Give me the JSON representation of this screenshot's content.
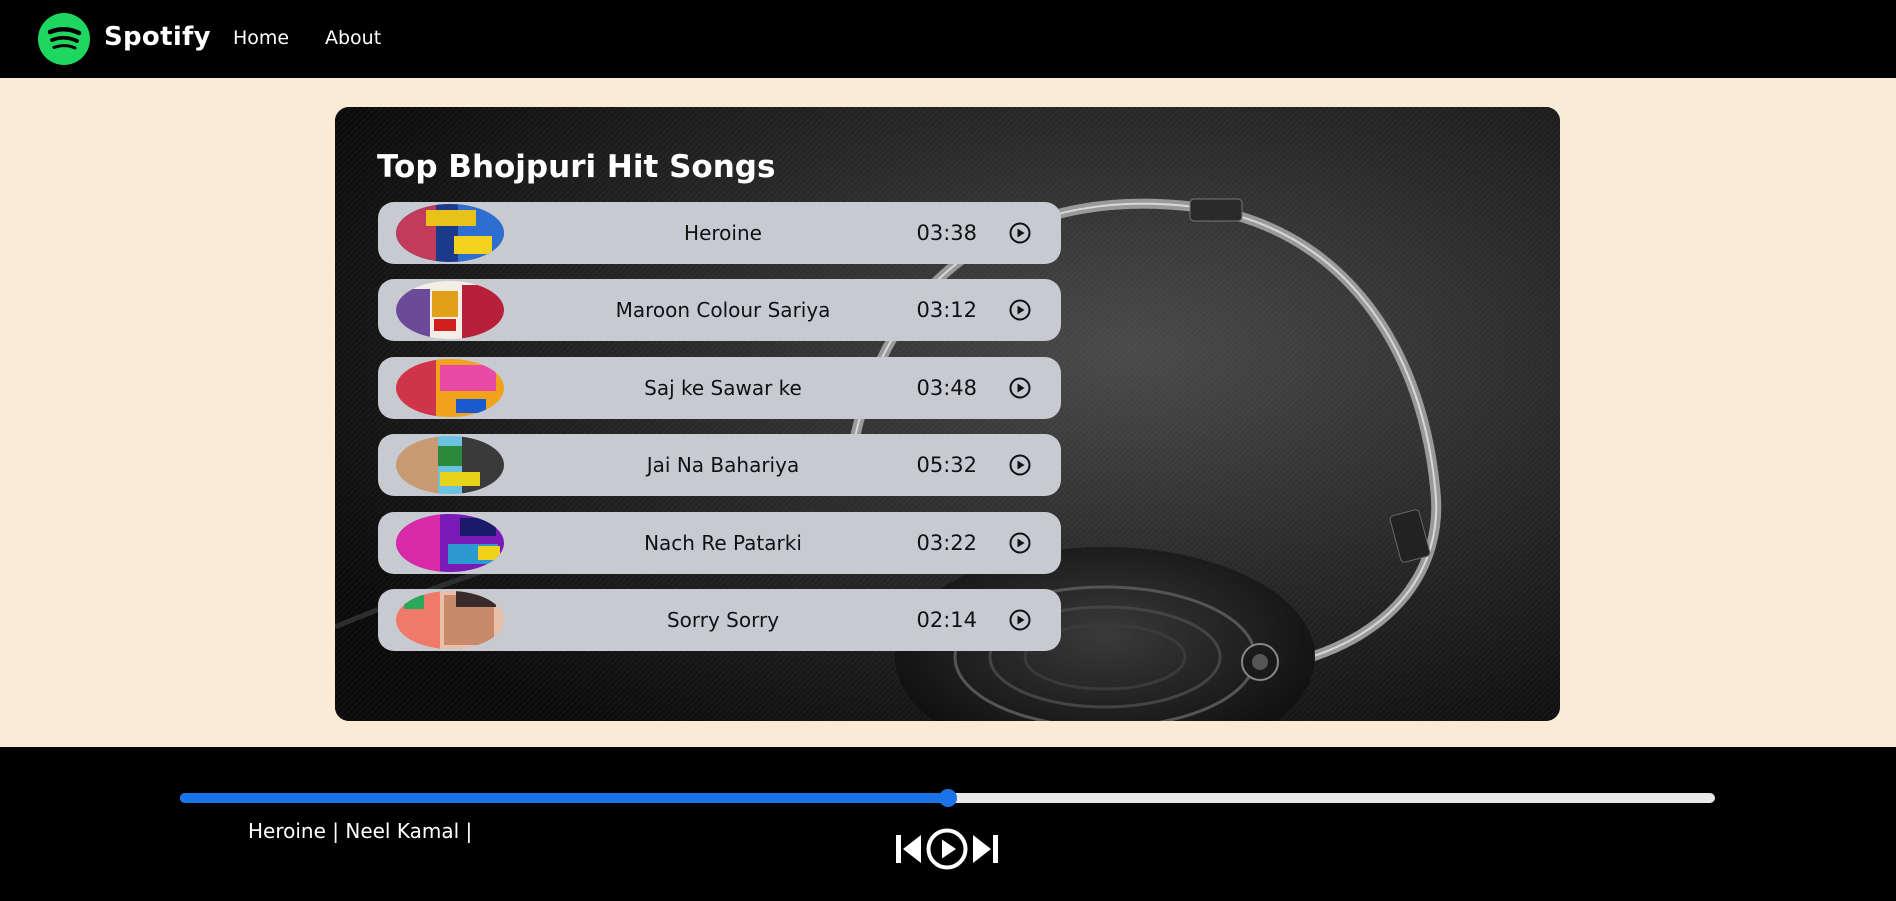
{
  "navbar": {
    "brand": "Spotify",
    "links": [
      "Home",
      "About"
    ]
  },
  "song_list": {
    "title": "Top Bhojpuri Hit Songs",
    "songs": [
      {
        "name": "Heroine",
        "duration": "03:38"
      },
      {
        "name": "Maroon Colour Sariya",
        "duration": "03:12"
      },
      {
        "name": "Saj ke Sawar ke",
        "duration": "03:48"
      },
      {
        "name": "Jai Na Bahariya",
        "duration": "05:32"
      },
      {
        "name": "Nach Re Patarki",
        "duration": "03:22"
      },
      {
        "name": "Sorry Sorry",
        "duration": "02:14"
      }
    ]
  },
  "player": {
    "now_playing": "Heroine | Neel Kamal |",
    "progress": 0.5,
    "controls": [
      "previous-icon",
      "play-icon",
      "next-icon"
    ]
  },
  "colors": {
    "brand_green": "#1ed760",
    "navbar_bg": "#000000",
    "page_bg": "#faebd7",
    "song_row_bg": "#c7cad1",
    "progress_accent": "#1a73e8"
  }
}
